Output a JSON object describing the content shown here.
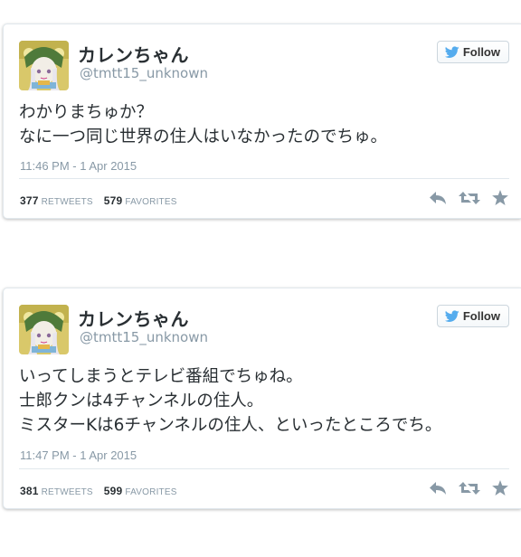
{
  "tweets": [
    {
      "name": "カレンちゃん",
      "handle": "@tmtt15_unknown",
      "follow_label": "Follow",
      "lines": [
        "わかりまちゅか？",
        "なに一つ同じ世界の住人はいなかったのでちゅ。"
      ],
      "timestamp": "11:46 PM - 1 Apr 2015",
      "retweets": "377",
      "retweets_label": "RETWEETS",
      "favorites": "579",
      "favorites_label": "FAVORITES"
    },
    {
      "name": "カレンちゃん",
      "handle": "@tmtt15_unknown",
      "follow_label": "Follow",
      "lines": [
        "いってしまうとテレビ番組でちゅね。",
        "士郎クンは4チャンネルの住人。",
        "ミスターKは6チャンネルの住人、といったところでち。"
      ],
      "timestamp": "11:47 PM - 1 Apr 2015",
      "retweets": "381",
      "retweets_label": "RETWEETS",
      "favorites": "599",
      "favorites_label": "FAVORITES"
    }
  ],
  "icons": {
    "follow": "twitter-bird-icon",
    "reply": "reply-icon",
    "retweet": "retweet-icon",
    "favorite": "star-icon"
  },
  "colors": {
    "bird": "#55acee",
    "muted": "#8899a6",
    "action": "#8899a6"
  }
}
